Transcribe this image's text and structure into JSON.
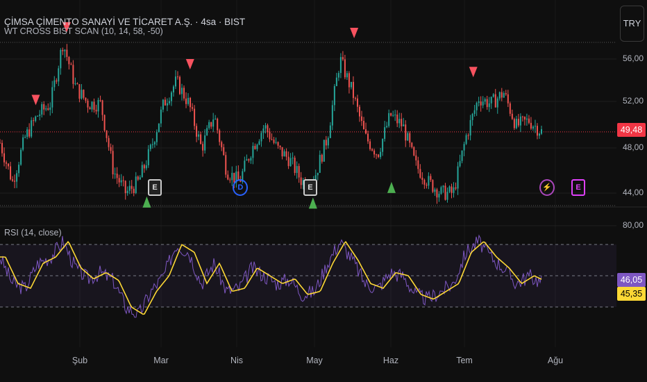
{
  "header": {
    "title": "ÇİMSA ÇİMENTO SANAYİ VE TİCARET A.Ş. · 4sa · BIST",
    "indicator": "WT CROSS BIST SCAN (10, 14, 58, -50)",
    "currency_button": "TRY"
  },
  "price_axis": {
    "ticks": [
      "56,00",
      "52,00",
      "48,00",
      "44,00"
    ],
    "tick_values": [
      56,
      52,
      48,
      44
    ],
    "last_price": "49,48",
    "last_price_value": 49.48
  },
  "rsi": {
    "label": "RSI (14, close)",
    "ticks": [
      "80,00"
    ],
    "rsi_value": "46,05",
    "ma_value": "45,35",
    "bands": [
      70,
      50,
      30
    ]
  },
  "x_axis": {
    "months": [
      "Şub",
      "Mar",
      "Nis",
      "May",
      "Haz",
      "Tem",
      "Ağu"
    ]
  },
  "colors": {
    "up": "#26a69a",
    "down": "#ef5350",
    "sell": "#f7525f",
    "buy": "#4caf50",
    "rsi": "#7e57c2",
    "rsi_ma": "#fdd835",
    "last": "#f23645"
  },
  "price_path": [
    48.5,
    45,
    49,
    51,
    52,
    57.5,
    53.5,
    52,
    52,
    46,
    44,
    45,
    48,
    52,
    54,
    52,
    48,
    51,
    46,
    45,
    48,
    50,
    48,
    47,
    45,
    45.5,
    49,
    56,
    53,
    49,
    47.5,
    51,
    50,
    46.5,
    45,
    44,
    44,
    49,
    52.5,
    52,
    53,
    50,
    50.5,
    49.5
  ],
  "rsi_path": [
    62,
    45,
    42,
    58,
    62,
    72,
    55,
    48,
    52,
    47,
    30,
    25,
    40,
    50,
    70,
    65,
    45,
    58,
    40,
    42,
    55,
    50,
    45,
    48,
    38,
    40,
    58,
    72,
    60,
    45,
    42,
    52,
    50,
    38,
    35,
    40,
    45,
    65,
    72,
    62,
    55,
    45,
    50,
    46
  ],
  "signals": [
    {
      "type": "sell",
      "t": 0.123,
      "p": 58.8
    },
    {
      "type": "sell",
      "t": 0.066,
      "p": 52.3
    },
    {
      "type": "sell",
      "t": 0.351,
      "p": 55.5
    },
    {
      "type": "sell",
      "t": 0.654,
      "p": 58.3
    },
    {
      "type": "sell",
      "t": 0.874,
      "p": 54.8
    },
    {
      "type": "buy",
      "t": 0.271,
      "p": 43.2
    },
    {
      "type": "buy",
      "t": 0.578,
      "p": 43.1
    },
    {
      "type": "buy",
      "t": 0.723,
      "p": 44.5
    }
  ],
  "events": [
    {
      "label": "E",
      "kind": "earnings",
      "t": 0.286
    },
    {
      "label": "D",
      "kind": "dividend",
      "t": 0.444
    },
    {
      "label": "E",
      "kind": "earnings",
      "t": 0.573
    },
    {
      "label": "⚡",
      "kind": "news",
      "t": 1.01
    },
    {
      "label": "E",
      "kind": "earnings-upcoming",
      "t": 1.068
    }
  ]
}
